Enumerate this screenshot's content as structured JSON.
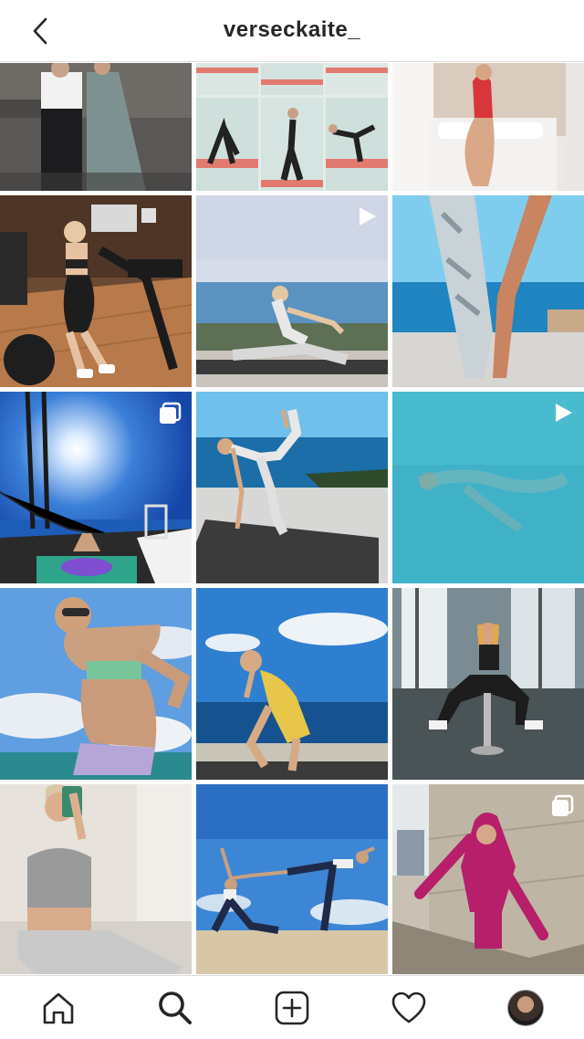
{
  "header": {
    "username": "verseckaite_"
  },
  "posts": [
    {
      "scene": "couple-dress-photo",
      "overlay": "none"
    },
    {
      "scene": "yoga-collage",
      "overlay": "none"
    },
    {
      "scene": "bathtub-mirror",
      "overlay": "none"
    },
    {
      "scene": "gym-workout",
      "overlay": "none"
    },
    {
      "scene": "yoga-seaview",
      "overlay": "video"
    },
    {
      "scene": "legs-sea",
      "overlay": "none"
    },
    {
      "scene": "sailboat-sky",
      "overlay": "carousel"
    },
    {
      "scene": "dancer-pose-terrace",
      "overlay": "none"
    },
    {
      "scene": "underwater-swim",
      "overlay": "video"
    },
    {
      "scene": "bikini-sky",
      "overlay": "none"
    },
    {
      "scene": "squat-yellow-swimsuit",
      "overlay": "none"
    },
    {
      "scene": "chair-pose-studio",
      "overlay": "none"
    },
    {
      "scene": "mirror-selfie-grey",
      "overlay": "none"
    },
    {
      "scene": "partner-yoga-beach",
      "overlay": "none"
    },
    {
      "scene": "pink-hoodie-stairs",
      "overlay": "carousel"
    }
  ],
  "nav": [
    {
      "name": "home-icon"
    },
    {
      "name": "search-icon"
    },
    {
      "name": "new-post-icon"
    },
    {
      "name": "heart-icon"
    },
    {
      "name": "profile-avatar"
    }
  ]
}
